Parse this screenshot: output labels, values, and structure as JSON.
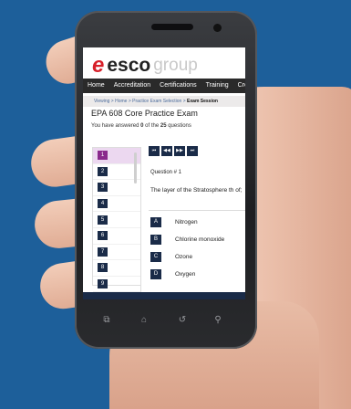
{
  "brand": {
    "logo_mark": "e",
    "logo_esco": "esco",
    "logo_group": "group"
  },
  "nav": {
    "items": [
      "Home",
      "Accreditation",
      "Certifications",
      "Training",
      "Creden"
    ]
  },
  "breadcrumb": {
    "trail": "Viewing > Home > Practice Exam Selection > ",
    "current": "Exam Session"
  },
  "exam": {
    "title": "EPA 608 Core Practice Exam",
    "answered_prefix": "You have answered ",
    "answered_count": "0",
    "answered_mid": " of the ",
    "total": "25",
    "answered_suffix": " questions"
  },
  "question_list": [
    "1",
    "2",
    "3",
    "4",
    "5",
    "6",
    "7",
    "8",
    "9"
  ],
  "nav_buttons": [
    "⏮",
    "◀◀",
    "▶▶",
    "⏭"
  ],
  "question": {
    "number_label": "Question # 1",
    "text": "The layer of the Stratosphere th of;",
    "options": [
      {
        "letter": "A",
        "text": "Nitrogen"
      },
      {
        "letter": "B",
        "text": "Chlorine monoxide"
      },
      {
        "letter": "C",
        "text": "Ozone"
      },
      {
        "letter": "D",
        "text": "Oxygen"
      }
    ]
  },
  "hardware_keys": [
    "⧉",
    "⌂",
    "↺",
    "⚲"
  ],
  "colors": {
    "background": "#1d5f9a",
    "accent_red": "#d7202a",
    "button_navy": "#1a2b48",
    "selected_purple": "#8a2a8c"
  }
}
